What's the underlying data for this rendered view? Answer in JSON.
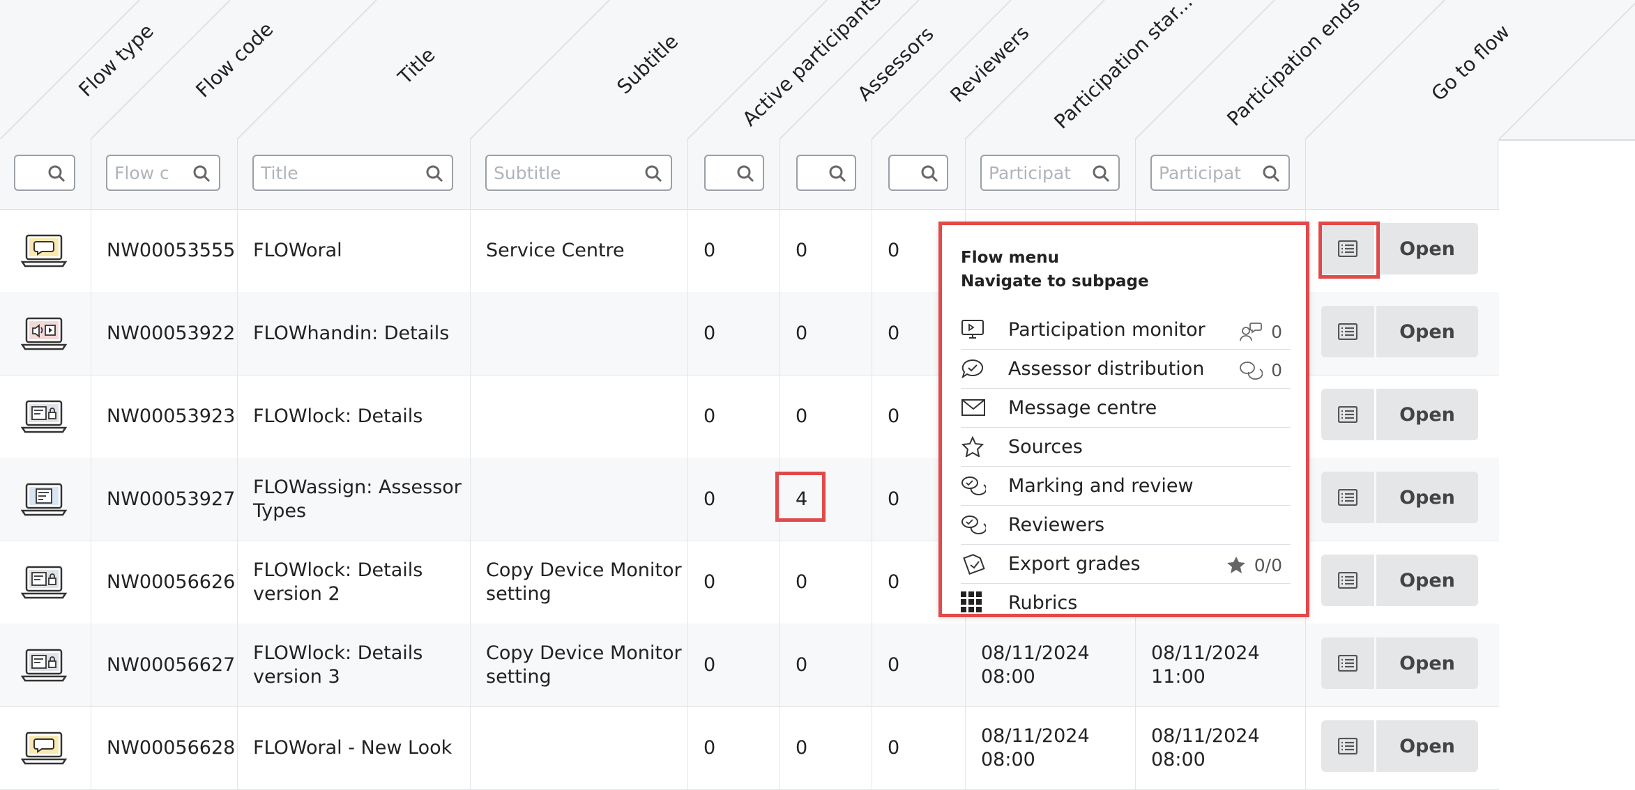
{
  "columns": [
    {
      "label": "Flow type"
    },
    {
      "label": "Flow code"
    },
    {
      "label": "Title"
    },
    {
      "label": "Subtitle"
    },
    {
      "label": "Active participants"
    },
    {
      "label": "Assessors"
    },
    {
      "label": "Reviewers"
    },
    {
      "label": "Participation star..."
    },
    {
      "label": "Participation ends"
    },
    {
      "label": "Go to flow"
    }
  ],
  "filters": {
    "flow_type": {
      "placeholder": ""
    },
    "flow_code": {
      "placeholder": "Flow c"
    },
    "title": {
      "placeholder": "Title"
    },
    "subtitle": {
      "placeholder": "Subtitle"
    },
    "active_participants": {
      "placeholder": ""
    },
    "assessors": {
      "placeholder": ""
    },
    "reviewers": {
      "placeholder": ""
    },
    "participation_starts": {
      "placeholder": "Participat"
    },
    "participation_ends": {
      "placeholder": "Participat"
    }
  },
  "rows": [
    {
      "flow_type_icon": "laptop-speech-bubble-icon",
      "code": "NW00053555",
      "title": "FLOWoral",
      "subtitle": "Service Centre",
      "active": "0",
      "assessors": "0",
      "reviewers": "0",
      "start": "",
      "end": "",
      "open_label": "Open"
    },
    {
      "flow_type_icon": "laptop-media-icon",
      "code": "NW00053922",
      "title": "FLOWhandin: Details",
      "subtitle": "",
      "active": "0",
      "assessors": "0",
      "reviewers": "0",
      "start": "",
      "end": "",
      "open_label": "Open"
    },
    {
      "flow_type_icon": "laptop-lock-icon",
      "code": "NW00053923",
      "title": "FLOWlock: Details",
      "subtitle": "",
      "active": "0",
      "assessors": "0",
      "reviewers": "0",
      "start": "",
      "end": "",
      "open_label": "Open"
    },
    {
      "flow_type_icon": "laptop-document-icon",
      "code": "NW00053927",
      "title": "FLOWassign: Assessor Types",
      "subtitle": "",
      "active": "0",
      "assessors": "4",
      "reviewers": "0",
      "start": "",
      "end": "",
      "open_label": "Open"
    },
    {
      "flow_type_icon": "laptop-lock-icon",
      "code": "NW00056626",
      "title": "FLOWlock: Details version 2",
      "subtitle": "Copy Device Monitor setting",
      "active": "0",
      "assessors": "0",
      "reviewers": "0",
      "start": "",
      "end": "",
      "open_label": "Open"
    },
    {
      "flow_type_icon": "laptop-lock-icon",
      "code": "NW00056627",
      "title": "FLOWlock: Details version 3",
      "subtitle": "Copy Device Monitor setting",
      "active": "0",
      "assessors": "0",
      "reviewers": "0",
      "start": "08/11/2024 08:00",
      "end": "08/11/2024 11:00",
      "open_label": "Open"
    },
    {
      "flow_type_icon": "laptop-speech-bubble-icon",
      "code": "NW00056628",
      "title": "FLOWoral - New Look",
      "subtitle": "",
      "active": "0",
      "assessors": "0",
      "reviewers": "0",
      "start": "08/11/2024 08:00",
      "end": "08/11/2024 08:00",
      "open_label": "Open"
    }
  ],
  "flow_menu": {
    "title": "Flow menu",
    "subtitle": "Navigate to subpage",
    "items": [
      {
        "label": "Participation monitor",
        "icon": "monitor-icon",
        "count": "0",
        "count_icon": "participant-chat-icon"
      },
      {
        "label": "Assessor distribution",
        "icon": "chat-check-icon",
        "count": "0",
        "count_icon": "double-chat-icon"
      },
      {
        "label": "Message centre",
        "icon": "envelope-icon",
        "count": "",
        "count_icon": ""
      },
      {
        "label": "Sources",
        "icon": "star-outline-icon",
        "count": "",
        "count_icon": ""
      },
      {
        "label": "Marking and review",
        "icon": "double-chat-icon",
        "count": "",
        "count_icon": ""
      },
      {
        "label": "Reviewers",
        "icon": "double-chat-icon",
        "count": "",
        "count_icon": ""
      },
      {
        "label": "Export grades",
        "icon": "export-document-icon",
        "count": "0/0",
        "count_icon": "star-filled-icon"
      },
      {
        "label": "Rubrics",
        "icon": "grid-icon",
        "count": "",
        "count_icon": ""
      }
    ]
  },
  "colors": {
    "highlight": "#e14a4a",
    "button_bg": "#e5e6e8",
    "header_bg": "#f6f7f9"
  }
}
